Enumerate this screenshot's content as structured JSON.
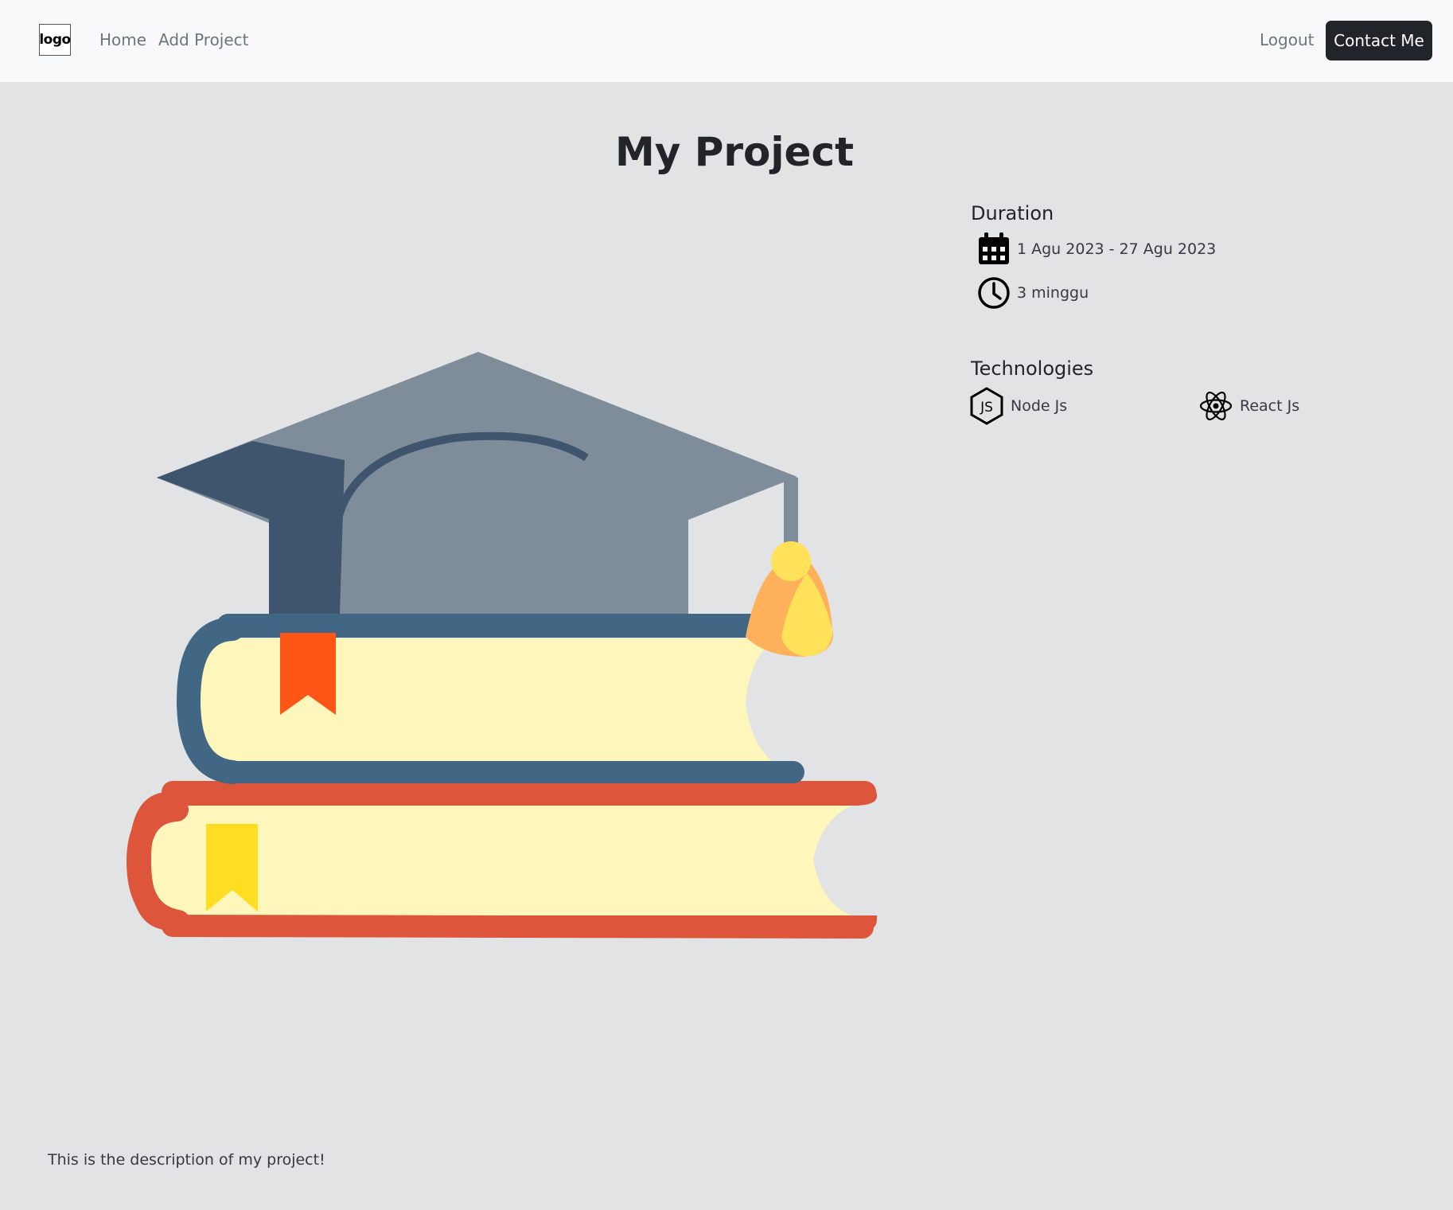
{
  "navbar": {
    "logo_text": "logo",
    "links": [
      "Home",
      "Add Project"
    ],
    "logout_label": "Logout",
    "contact_label": "Contact Me"
  },
  "project": {
    "title": "My Project",
    "duration": {
      "heading": "Duration",
      "date_range": "1 Agu 2023 - 27 Agu 2023",
      "length": "3 minggu"
    },
    "technologies": {
      "heading": "Technologies",
      "items": [
        {
          "label": "Node Js",
          "icon": "nodejs-icon"
        },
        {
          "label": "React Js",
          "icon": "react-icon"
        }
      ]
    },
    "image": "graduation-cap-books-illustration",
    "description": "This is the description of my project!"
  },
  "colors": {
    "page_background": "#e2e3e5",
    "navbar_background": "#f8f9fa",
    "contact_button": "#212529"
  }
}
